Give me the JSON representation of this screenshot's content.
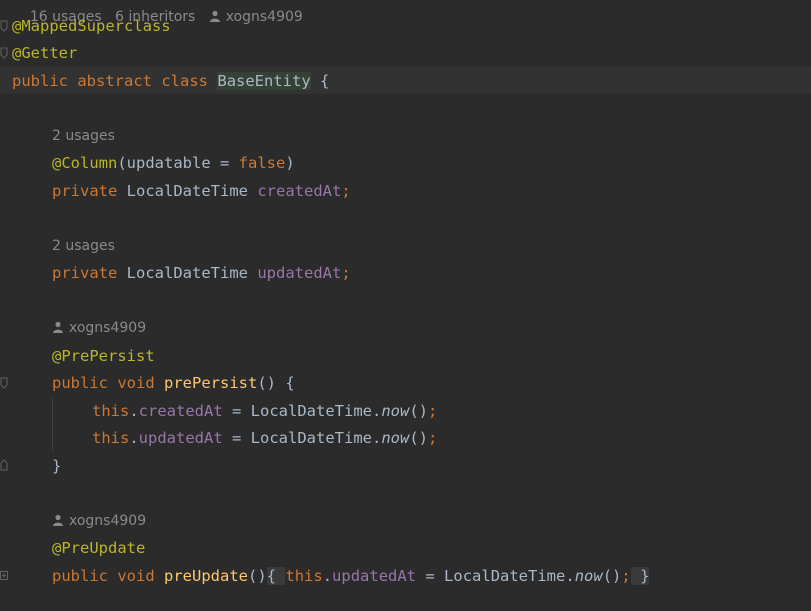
{
  "header_hint": {
    "usages": "16 usages",
    "inheritors": "6 inheritors",
    "author": "xogns4909"
  },
  "code": {
    "anno_mapped_superclass": "@MappedSuperclass",
    "anno_getter": "@Getter",
    "kw_public": "public",
    "kw_abstract": "abstract",
    "kw_class": "class",
    "class_name": "BaseEntity",
    "open_brace": "{",
    "usages_created": "2 usages",
    "anno_column": "@Column",
    "column_args_open": "(updatable = ",
    "kw_false": "false",
    "column_args_close": ")",
    "kw_private": "private",
    "type_local_date_time": "LocalDateTime",
    "field_created_at": "createdAt",
    "semicolon": ";",
    "usages_updated": "2 usages",
    "field_updated_at": "updatedAt",
    "author_pre_persist": "xogns4909",
    "anno_pre_persist": "@PrePersist",
    "kw_void": "void",
    "method_pre_persist": "prePersist",
    "parens_brace": "() {",
    "kw_this": "this",
    "dot": ".",
    "assign": " = ",
    "method_now": "now",
    "call_parens": "()",
    "close_brace": "}",
    "author_pre_update": "xogns4909",
    "anno_pre_update": "@PreUpdate",
    "method_pre_update": "preUpdate",
    "parens": "()",
    "folded_open": "{ ",
    "folded_close": "}"
  },
  "colors": {
    "background": "#2b2b2b",
    "annotation": "#bbb529",
    "keyword": "#cc7832",
    "field": "#9876aa",
    "method": "#ffc66d",
    "plain": "#a9b7c6",
    "hint": "#8a8a8a"
  },
  "icons": {
    "author": "person-icon",
    "gutter": "fold-marker-icon"
  }
}
